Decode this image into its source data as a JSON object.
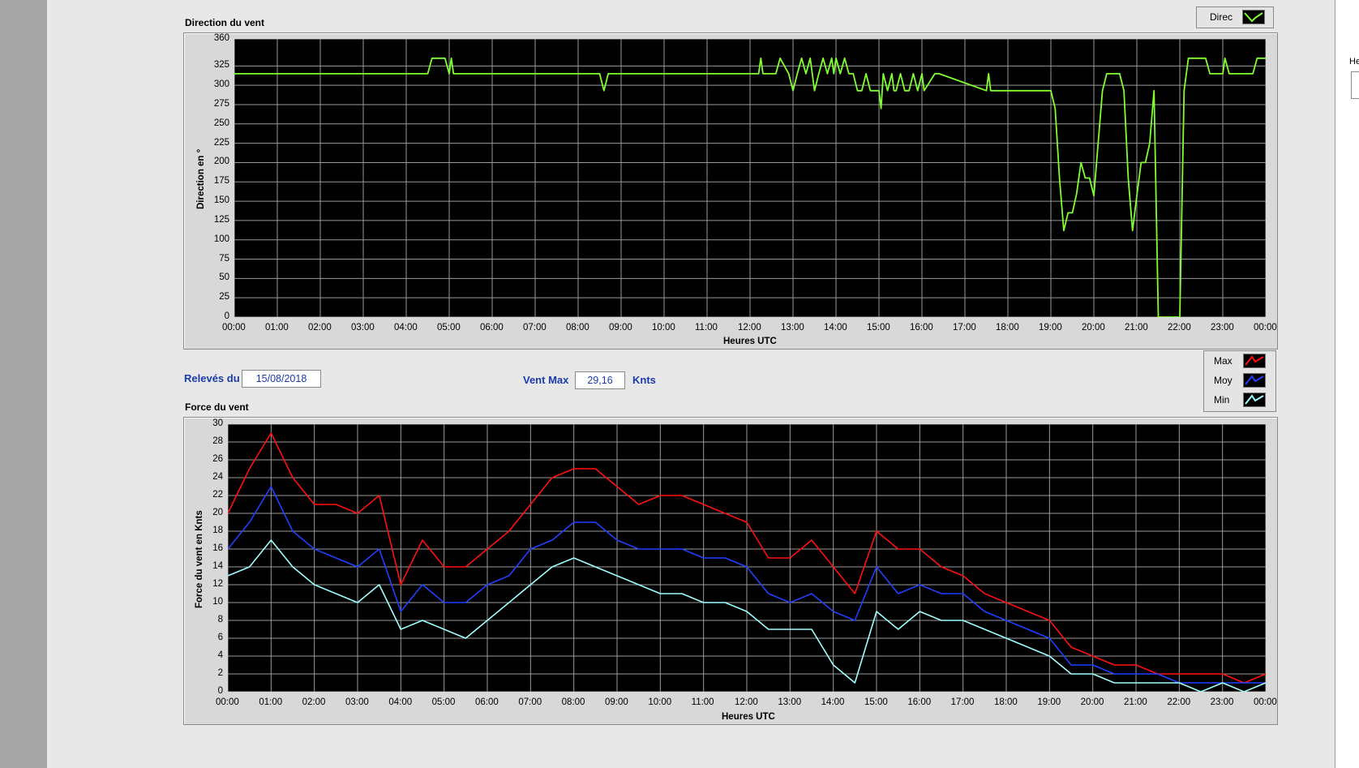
{
  "header": {
    "releves_label": "Relevés du",
    "releves_date": "15/08/2018",
    "vent_max_label": "Vent Max",
    "vent_max_value": "29,16",
    "vent_max_unit": "Knts"
  },
  "right_fragment": "He",
  "chart_data": [
    {
      "type": "line",
      "title": "Direction du vent",
      "xlabel": "Heures UTC",
      "ylabel": "Direction en °",
      "ylim": [
        0,
        360
      ],
      "y_ticks": [
        0,
        25,
        50,
        75,
        100,
        125,
        150,
        175,
        200,
        225,
        250,
        275,
        300,
        325,
        360
      ],
      "x_ticks": [
        "00:00",
        "01:00",
        "02:00",
        "03:00",
        "04:00",
        "05:00",
        "06:00",
        "07:00",
        "08:00",
        "09:00",
        "10:00",
        "11:00",
        "12:00",
        "13:00",
        "14:00",
        "15:00",
        "16:00",
        "17:00",
        "18:00",
        "19:00",
        "20:00",
        "21:00",
        "22:00",
        "23:00",
        "00:00"
      ],
      "grid": true,
      "legend_position": "top-right",
      "series": [
        {
          "name": "Direc",
          "color": "#80ff30",
          "x": [
            0,
            4.5,
            4.6,
            4.9,
            5.0,
            5.05,
            5.1,
            5.2,
            8.5,
            8.6,
            8.7,
            12.2,
            12.25,
            12.3,
            12.6,
            12.7,
            12.9,
            13.0,
            13.1,
            13.2,
            13.3,
            13.4,
            13.5,
            13.6,
            13.7,
            13.8,
            13.9,
            13.95,
            14.0,
            14.1,
            14.2,
            14.3,
            14.4,
            14.5,
            14.6,
            14.7,
            14.8,
            15.0,
            15.05,
            15.1,
            15.2,
            15.3,
            15.35,
            15.4,
            15.5,
            15.6,
            15.7,
            15.8,
            15.9,
            16.0,
            16.05,
            16.3,
            16.4,
            17.5,
            17.55,
            17.6,
            19.0,
            19.1,
            19.2,
            19.3,
            19.4,
            19.5,
            19.6,
            19.7,
            19.8,
            19.9,
            20.0,
            20.1,
            20.2,
            20.3,
            20.4,
            20.6,
            20.7,
            20.8,
            20.9,
            21.0,
            21.1,
            21.2,
            21.3,
            21.4,
            21.5,
            21.55,
            21.6,
            22.0,
            22.1,
            22.2,
            22.6,
            22.7,
            22.8,
            23.0,
            23.05,
            23.15,
            23.2,
            23.7,
            23.8,
            24.0
          ],
          "values": [
            315,
            315,
            335,
            335,
            315,
            335,
            315,
            315,
            315,
            293,
            315,
            315,
            335,
            315,
            315,
            335,
            315,
            293,
            315,
            335,
            315,
            335,
            293,
            315,
            335,
            315,
            335,
            315,
            335,
            315,
            335,
            315,
            315,
            293,
            293,
            315,
            293,
            293,
            270,
            315,
            293,
            315,
            293,
            293,
            315,
            293,
            293,
            315,
            293,
            315,
            293,
            315,
            315,
            293,
            315,
            293,
            293,
            270,
            180,
            112,
            135,
            135,
            160,
            200,
            180,
            180,
            157,
            225,
            293,
            315,
            315,
            315,
            293,
            180,
            112,
            157,
            200,
            200,
            225,
            293,
            0,
            0,
            0,
            0,
            293,
            335,
            335,
            315,
            315,
            315,
            335,
            315,
            315,
            315,
            335,
            335
          ]
        }
      ]
    },
    {
      "type": "line",
      "title": "Force du vent",
      "xlabel": "Heures UTC",
      "ylabel": "Force du vent en Knts",
      "ylim": [
        0,
        30
      ],
      "y_ticks": [
        0,
        2,
        4,
        6,
        8,
        10,
        12,
        14,
        16,
        18,
        20,
        22,
        24,
        26,
        28,
        30
      ],
      "x_ticks": [
        "00:00",
        "01:00",
        "02:00",
        "03:00",
        "04:00",
        "05:00",
        "06:00",
        "07:00",
        "08:00",
        "09:00",
        "10:00",
        "11:00",
        "12:00",
        "13:00",
        "14:00",
        "15:00",
        "16:00",
        "17:00",
        "18:00",
        "19:00",
        "20:00",
        "21:00",
        "22:00",
        "23:00",
        "00:00"
      ],
      "grid": true,
      "legend_position": "top-right",
      "x": [
        0,
        0.5,
        1,
        1.5,
        2,
        2.5,
        3,
        3.5,
        4,
        4.5,
        5,
        5.5,
        6,
        6.5,
        7,
        7.5,
        8,
        8.5,
        9,
        9.5,
        10,
        10.5,
        11,
        11.5,
        12,
        12.5,
        13,
        13.5,
        14,
        14.5,
        15,
        15.5,
        16,
        16.5,
        17,
        17.5,
        18,
        18.5,
        19,
        19.5,
        20,
        20.5,
        21,
        21.5,
        22,
        22.5,
        23,
        23.5,
        24
      ],
      "series": [
        {
          "name": "Max",
          "color": "#ff1010",
          "values": [
            20,
            25,
            29,
            24,
            21,
            21,
            20,
            22,
            12,
            17,
            14,
            14,
            16,
            18,
            21,
            24,
            25,
            25,
            23,
            21,
            22,
            22,
            21,
            20,
            19,
            15,
            15,
            17,
            14,
            11,
            18,
            16,
            16,
            14,
            13,
            11,
            10,
            9,
            8,
            5,
            4,
            3,
            3,
            2,
            2,
            2,
            2,
            1,
            2
          ]
        },
        {
          "name": "Moy",
          "color": "#2040ff",
          "values": [
            16,
            19,
            23,
            18,
            16,
            15,
            14,
            16,
            9,
            12,
            10,
            10,
            12,
            13,
            16,
            17,
            19,
            19,
            17,
            16,
            16,
            16,
            15,
            15,
            14,
            11,
            10,
            11,
            9,
            8,
            14,
            11,
            12,
            11,
            11,
            9,
            8,
            7,
            6,
            3,
            3,
            2,
            2,
            2,
            1,
            1,
            1,
            1,
            1
          ]
        },
        {
          "name": "Min",
          "color": "#a0ffff",
          "values": [
            13,
            14,
            17,
            14,
            12,
            11,
            10,
            12,
            7,
            8,
            7,
            6,
            8,
            10,
            12,
            14,
            15,
            14,
            13,
            12,
            11,
            11,
            10,
            10,
            9,
            7,
            7,
            7,
            3,
            1,
            9,
            7,
            9,
            8,
            8,
            7,
            6,
            5,
            4,
            2,
            2,
            1,
            1,
            1,
            1,
            0,
            1,
            0,
            1
          ]
        }
      ]
    }
  ]
}
